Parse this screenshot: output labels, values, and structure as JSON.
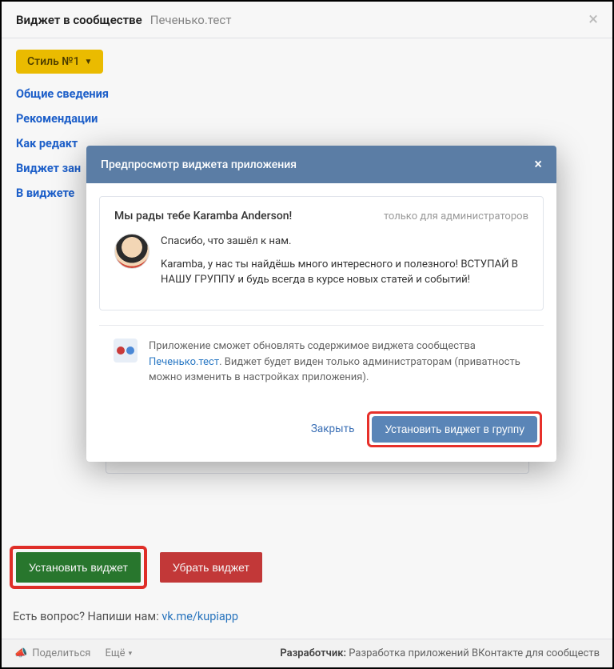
{
  "topbar": {
    "title": "Виджет в сообществе",
    "subtitle": "Печенько.тест",
    "close": "×"
  },
  "style_button": {
    "label": "Стиль №1",
    "caret": "▼"
  },
  "nav": [
    "Общие сведения",
    "Рекомендации",
    "Как редакт",
    "Виджет зан",
    "В виджете"
  ],
  "bg_card": {
    "text": "НАШУ ГРУППУ и будь всегда в курсе новых статей и событий!"
  },
  "buttons": {
    "install": "Установить виджет",
    "remove": "Убрать виджет"
  },
  "question": {
    "prefix": "Есть вопрос? Напиши нам: ",
    "link": "vk.me/kupiapp"
  },
  "footer": {
    "share": "Поделиться",
    "more": "Ещё",
    "dev_label": "Разработчик:",
    "dev_value": "Разработка приложений ВКонтакте для сообществ"
  },
  "modal": {
    "title": "Предпросмотр виджета приложения",
    "close": "×",
    "card_title": "Мы рады тебе Karamba Anderson!",
    "admins_only": "только для администраторов",
    "greeting": "Спасибо, что зашёл к нам.",
    "body": "Karamba, у нас ты найдёшь много интересного и полезного! ВСТУПАЙ В НАШУ ГРУППУ и будь всегда в курсе новых статей и событий!",
    "info_prefix": "Приложение сможет обновлять содержимое виджета сообщества ",
    "info_link": "Печенько.тест",
    "info_suffix": ". Виджет будет виден только администраторам (приватность можно изменить в настройках приложения).",
    "close_btn": "Закрыть",
    "install_btn": "Установить виджет в группу"
  }
}
